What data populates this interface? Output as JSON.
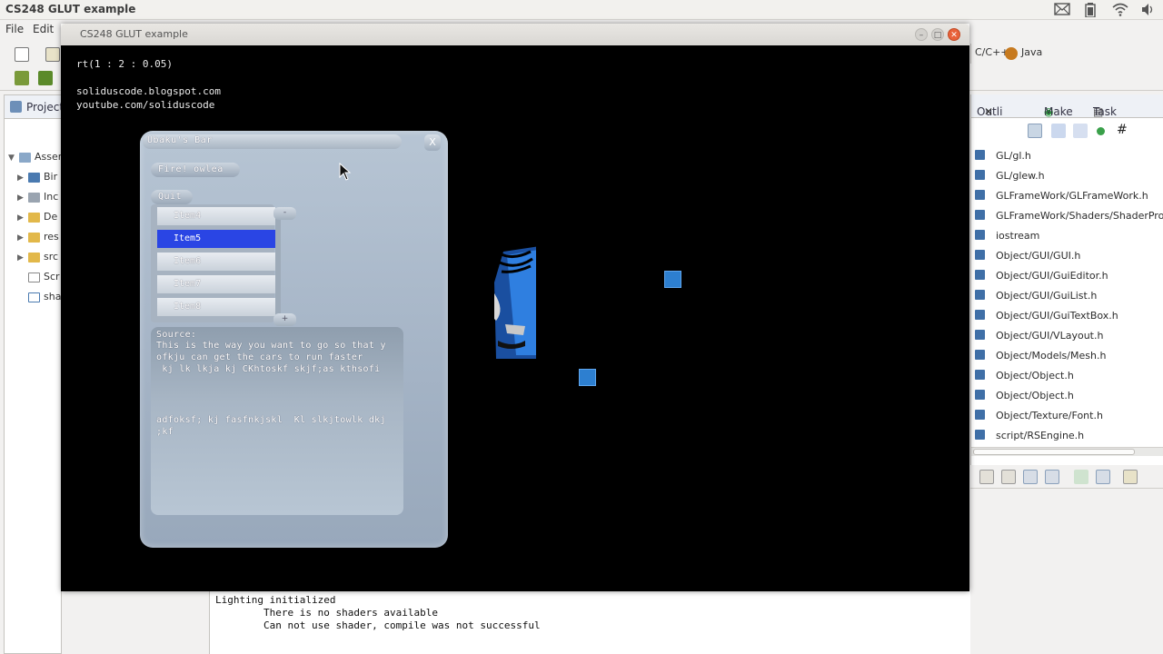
{
  "system_bar": {
    "title": "CS248 GLUT example"
  },
  "ide": {
    "menu": [
      "File",
      "Edit"
    ],
    "perspectives": [
      "C/C++",
      "Java"
    ],
    "left_tab": "Project",
    "tree": [
      "Asser",
      "Bir",
      "Inc",
      "De",
      "res",
      "src",
      "Scr",
      "sha"
    ],
    "outline_tabs": [
      "Outli",
      "Make",
      "Task"
    ],
    "outline_items": [
      "GL/gl.h",
      "GL/glew.h",
      "GLFrameWork/GLFrameWork.h",
      "GLFrameWork/Shaders/ShaderProgra",
      "iostream",
      "Object/GUI/GUI.h",
      "Object/GUI/GuiEditor.h",
      "Object/GUI/GuiList.h",
      "Object/GUI/GuiTextBox.h",
      "Object/GUI/VLayout.h",
      "Object/Models/Mesh.h",
      "Object/Object.h",
      "Object/Object.h",
      "Object/Texture/Font.h",
      "script/RSEngine.h"
    ],
    "console": [
      "Lighting initialized",
      "        There is no shaders available",
      "        Can not use shader, compile was not successful"
    ]
  },
  "glut_window": {
    "title": "CS248 GLUT example",
    "overlay": [
      "rt(1 : 2 : 0.05)",
      "soliduscode.blogspot.com",
      "youtube.com/soliduscode"
    ]
  },
  "gui": {
    "title": "Ubaku's Bar",
    "close": "X",
    "fire_button": "Fire!  owlea",
    "quit_button": "Quit",
    "list_items": [
      "Item4",
      "Item5",
      "Item6",
      "Item7",
      "Item8"
    ],
    "selected_index": 1,
    "scroll_up": "-",
    "scroll_down": "+",
    "textbox_lines_1": [
      "Source:",
      "This is the way you want to go so that y",
      "ofkju can get the cars to run faster",
      " kj lk lkja kj CKhtoskf skjf;as kthsofi"
    ],
    "textbox_lines_2": [
      "adfoksf; kj fasfnkjskl  Kl slkjtowlk dkj",
      ";kf"
    ]
  },
  "colors": {
    "selected_item": "#2a45e4",
    "square": "#2d7fd0",
    "close_button": "#e8623a"
  }
}
